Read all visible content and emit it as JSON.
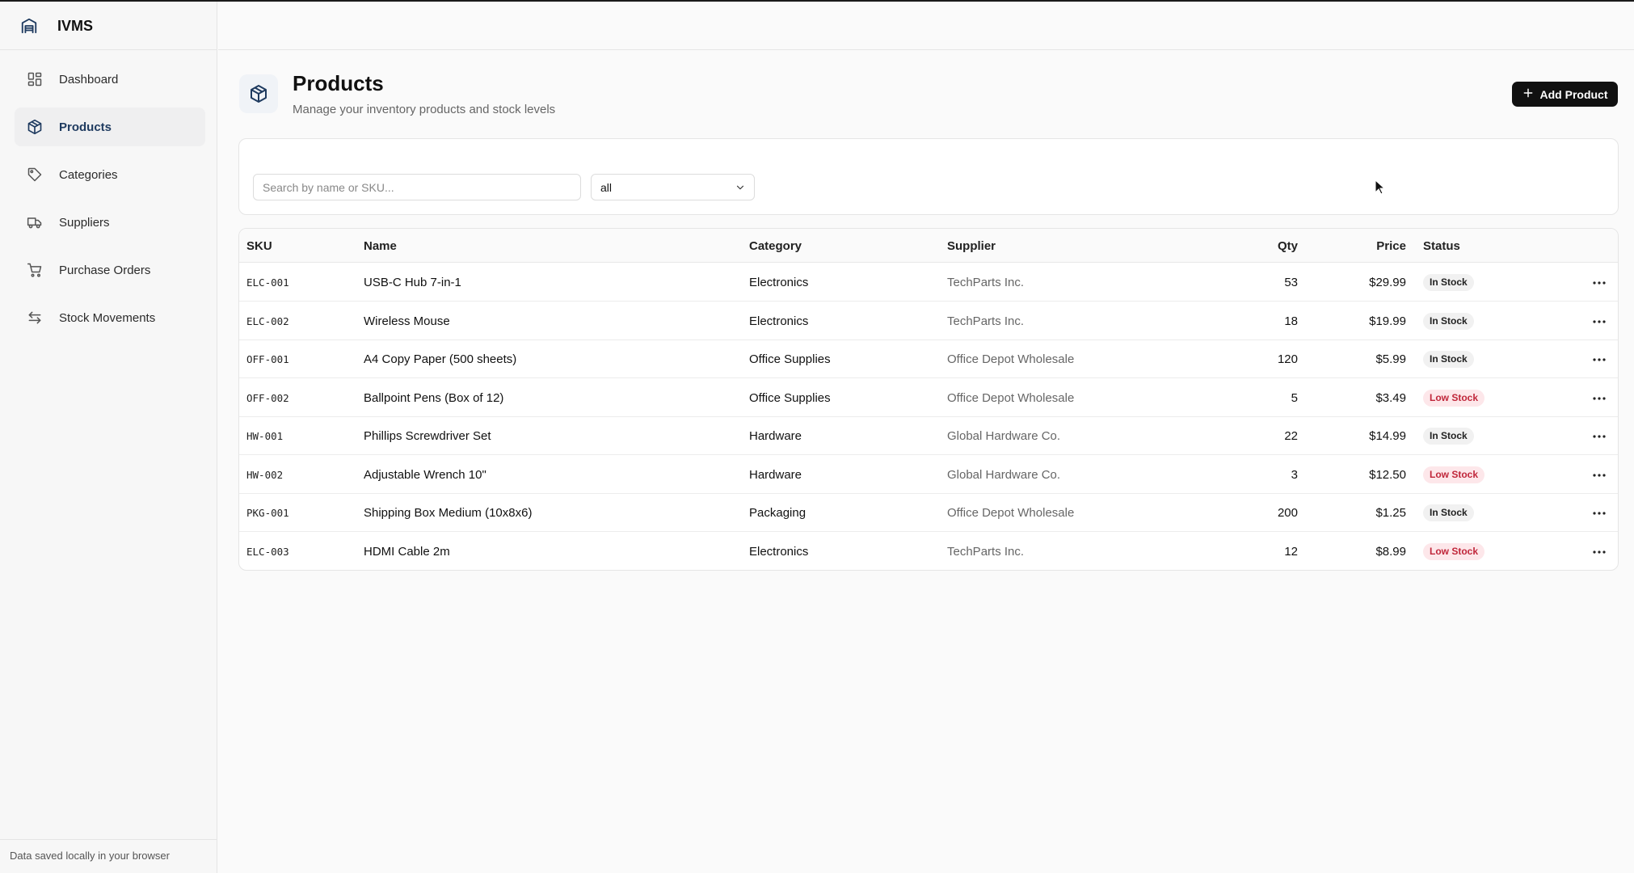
{
  "app": {
    "name": "IVMS"
  },
  "sidebar": {
    "items": [
      {
        "label": "Dashboard",
        "icon": "dashboard-grid-icon"
      },
      {
        "label": "Products",
        "icon": "box-icon",
        "active": true
      },
      {
        "label": "Categories",
        "icon": "tag-icon"
      },
      {
        "label": "Suppliers",
        "icon": "truck-icon"
      },
      {
        "label": "Purchase Orders",
        "icon": "cart-icon"
      },
      {
        "label": "Stock Movements",
        "icon": "arrows-swap-icon"
      }
    ],
    "footer": "Data saved locally in your browser"
  },
  "page": {
    "title": "Products",
    "subtitle": "Manage your inventory products and stock levels",
    "add_button": "Add Product"
  },
  "filters": {
    "search_placeholder": "Search by name or SKU...",
    "status_value": "all"
  },
  "table": {
    "headers": {
      "sku": "SKU",
      "name": "Name",
      "category": "Category",
      "supplier": "Supplier",
      "qty": "Qty",
      "price": "Price",
      "status": "Status"
    },
    "rows": [
      {
        "sku": "ELC-001",
        "name": "USB-C Hub 7-in-1",
        "category": "Electronics",
        "supplier": "TechParts Inc.",
        "qty": "53",
        "price": "$29.99",
        "status": "In Stock"
      },
      {
        "sku": "ELC-002",
        "name": "Wireless Mouse",
        "category": "Electronics",
        "supplier": "TechParts Inc.",
        "qty": "18",
        "price": "$19.99",
        "status": "In Stock"
      },
      {
        "sku": "OFF-001",
        "name": "A4 Copy Paper (500 sheets)",
        "category": "Office Supplies",
        "supplier": "Office Depot Wholesale",
        "qty": "120",
        "price": "$5.99",
        "status": "In Stock"
      },
      {
        "sku": "OFF-002",
        "name": "Ballpoint Pens (Box of 12)",
        "category": "Office Supplies",
        "supplier": "Office Depot Wholesale",
        "qty": "5",
        "price": "$3.49",
        "status": "Low Stock"
      },
      {
        "sku": "HW-001",
        "name": "Phillips Screwdriver Set",
        "category": "Hardware",
        "supplier": "Global Hardware Co.",
        "qty": "22",
        "price": "$14.99",
        "status": "In Stock"
      },
      {
        "sku": "HW-002",
        "name": "Adjustable Wrench 10\"",
        "category": "Hardware",
        "supplier": "Global Hardware Co.",
        "qty": "3",
        "price": "$12.50",
        "status": "Low Stock"
      },
      {
        "sku": "PKG-001",
        "name": "Shipping Box Medium (10x8x6)",
        "category": "Packaging",
        "supplier": "Office Depot Wholesale",
        "qty": "200",
        "price": "$1.25",
        "status": "In Stock"
      },
      {
        "sku": "ELC-003",
        "name": "HDMI Cable 2m",
        "category": "Electronics",
        "supplier": "TechParts Inc.",
        "qty": "12",
        "price": "$8.99",
        "status": "Low Stock"
      }
    ]
  },
  "colors": {
    "accent": "#1e3a5f",
    "low_stock_bg": "#fde7ea",
    "low_stock_text": "#c0263a",
    "button_bg": "#111111"
  }
}
